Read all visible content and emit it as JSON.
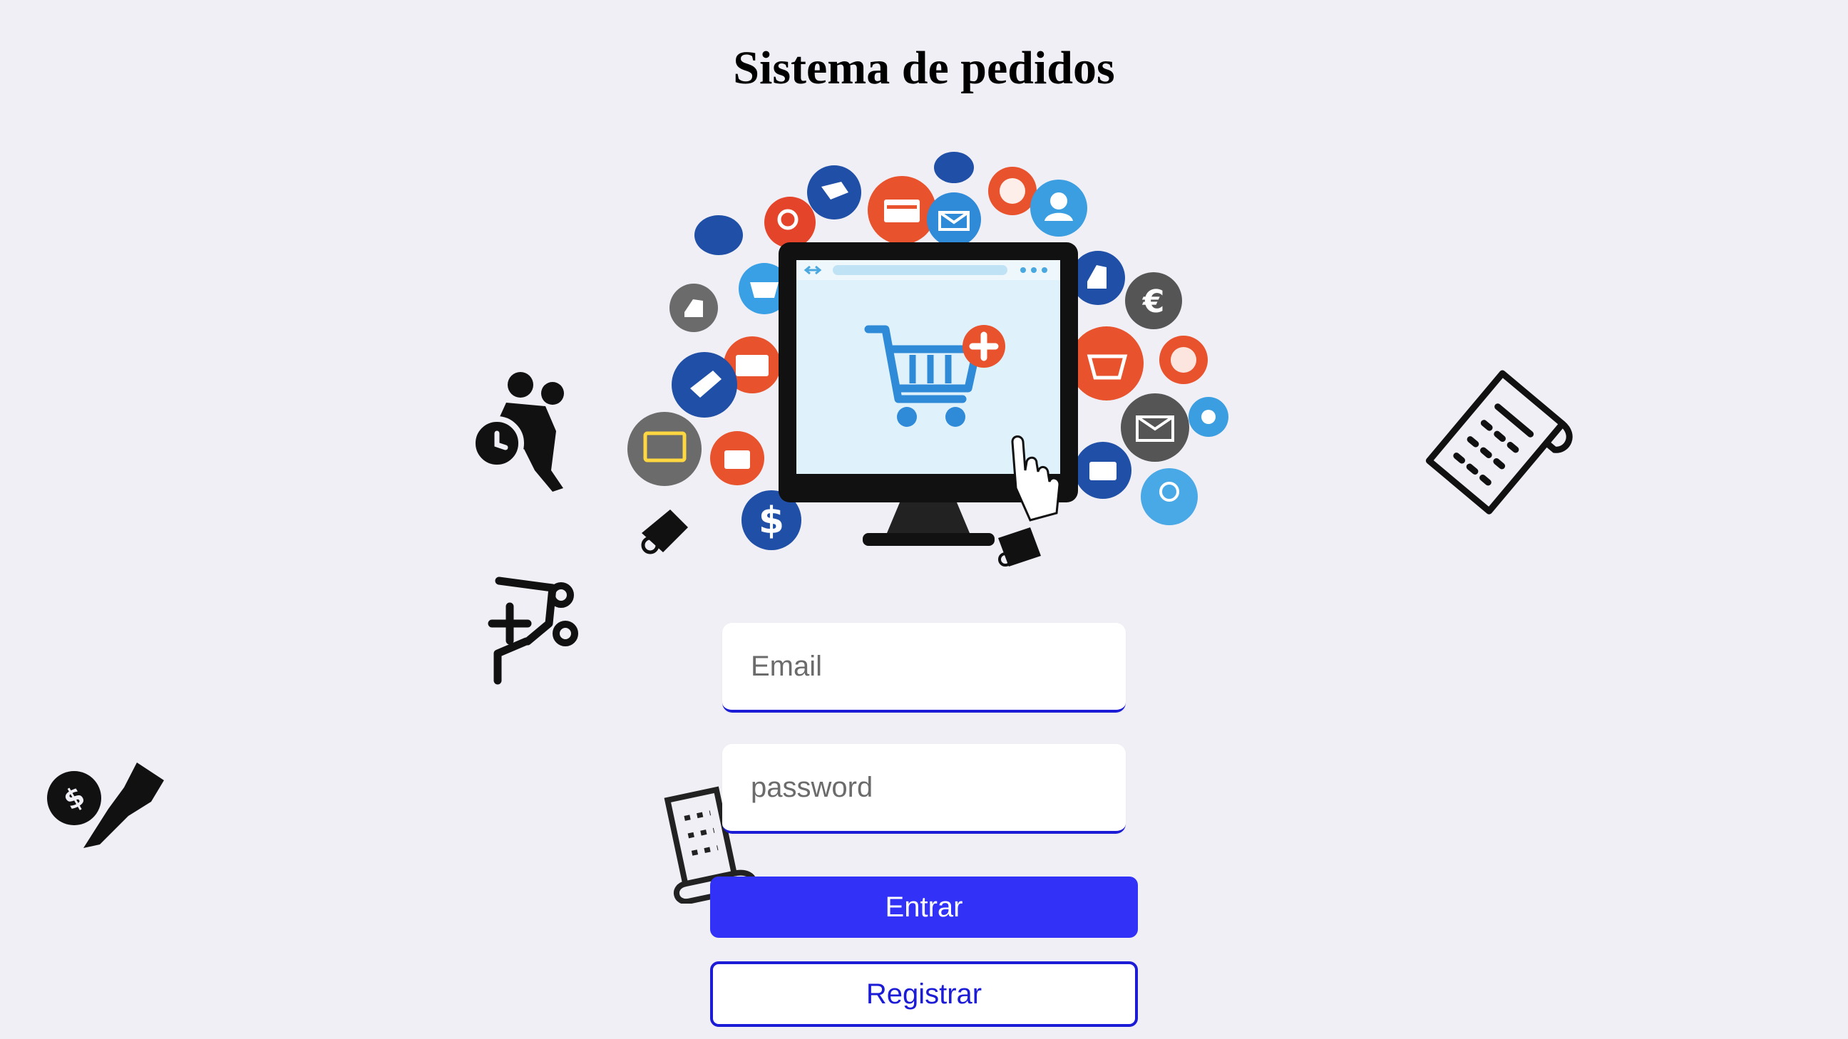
{
  "page": {
    "title": "Sistema de pedidos"
  },
  "login_form": {
    "email_placeholder": "Email",
    "password_placeholder": "password",
    "submit_label": "Entrar",
    "register_label": "Registrar"
  },
  "colors": {
    "background": "#f0eff5",
    "primary_button": "#3131f7",
    "accent_border": "#1c1cd6",
    "text": "#000000"
  },
  "icons": {
    "hero": "online-shopping-illustration-icon",
    "floating": [
      "delivery-clock-icon",
      "add-to-cart-icon",
      "payment-hand-icon",
      "receipt-icon",
      "receipt-tilted-icon"
    ]
  }
}
